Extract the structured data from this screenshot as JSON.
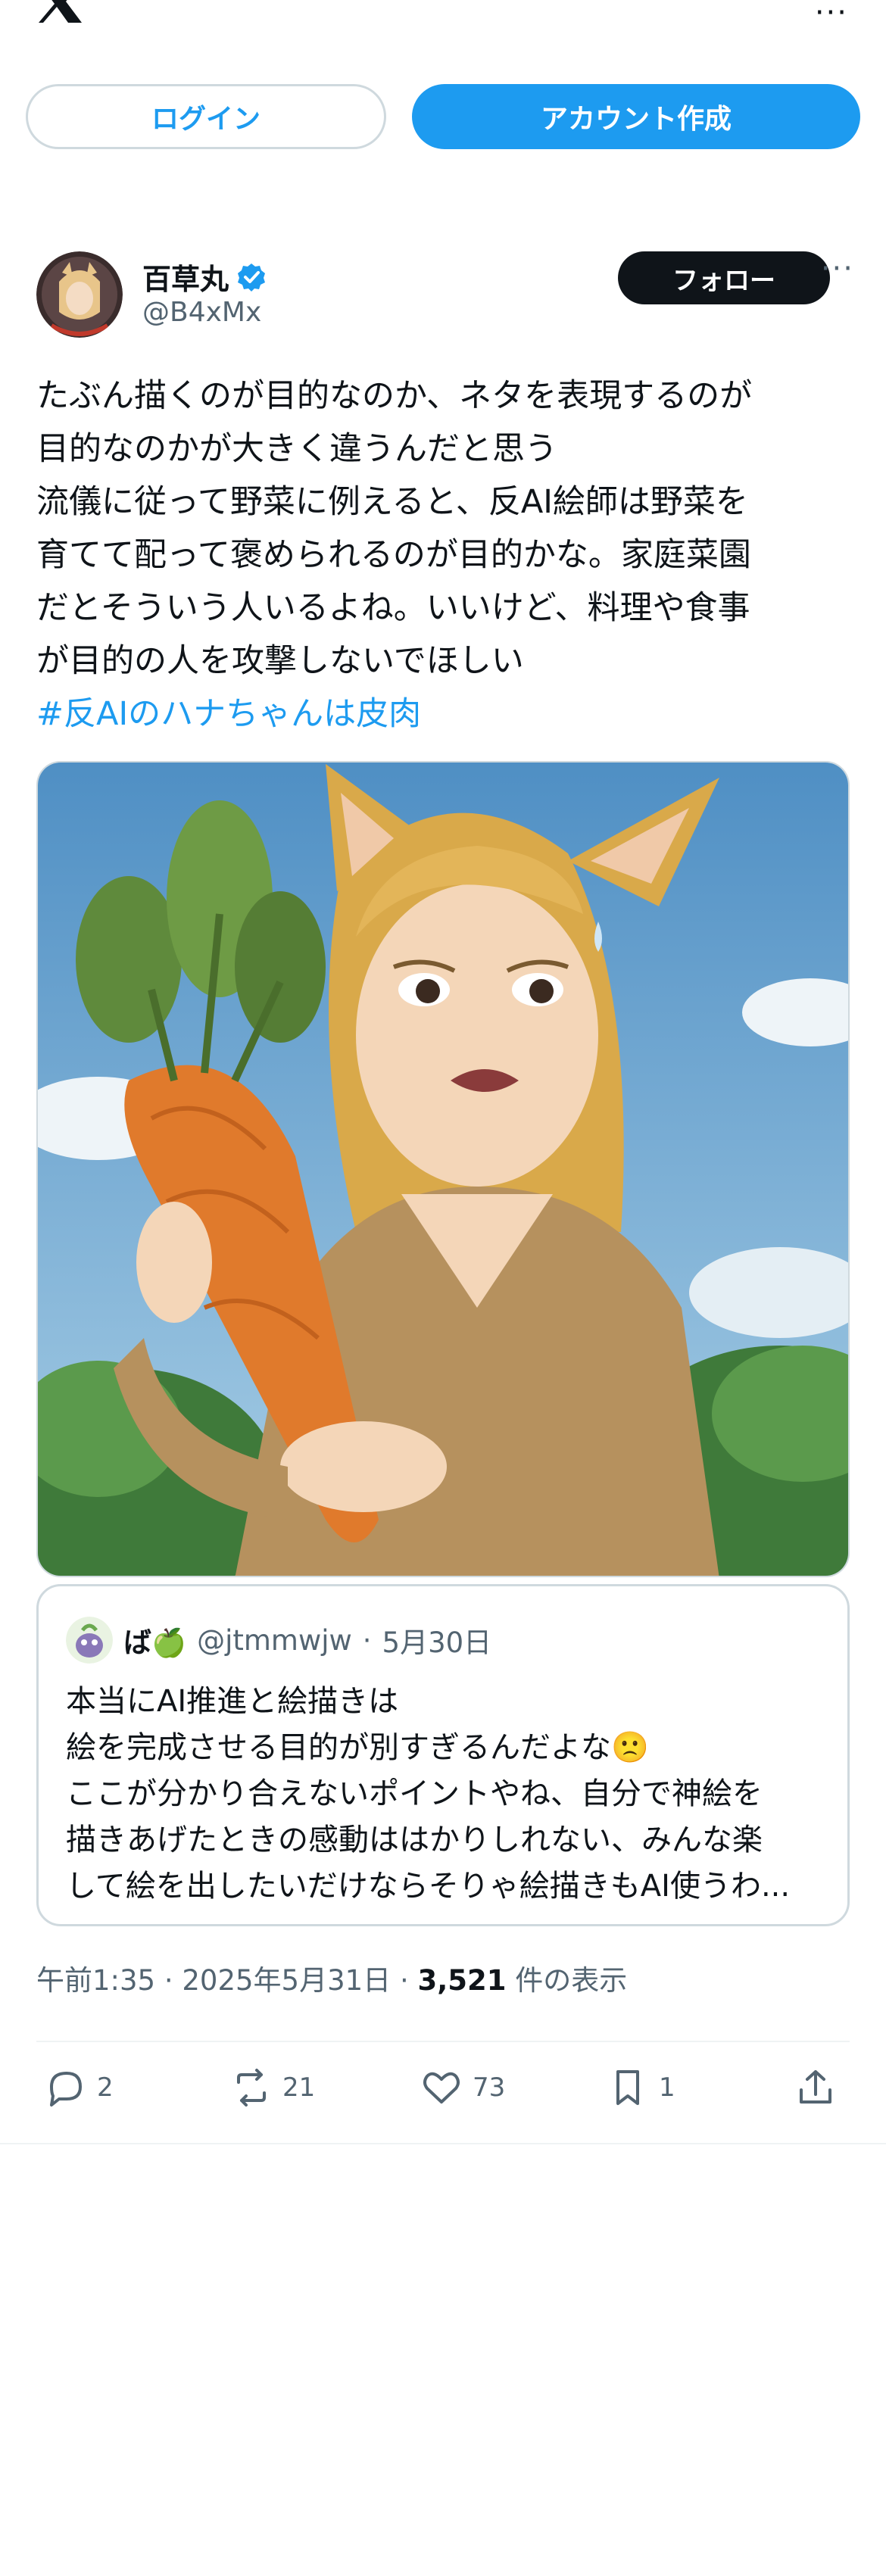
{
  "topbar": {
    "logo_icon": "x-logo-icon",
    "more_icon": "more-horizontal-icon",
    "more_glyph": "···"
  },
  "auth": {
    "login_label": "ログイン",
    "signup_label": "アカウント作成"
  },
  "author": {
    "display_name": "百草丸",
    "handle": "@B4xMx",
    "verified_icon": "verified-badge-icon",
    "follow_label": "フォロー",
    "more_glyph": "···"
  },
  "tweet": {
    "lines": [
      "たぶん描くのが目的なのか、ネタを表現するのが",
      "目的なのかが大きく違うんだと思う",
      "流儀に従って野菜に例えると、反AI絵師は野菜を",
      "育てて配って褒められるのが目的かな。家庭菜園",
      "だとそういう人いるよね。いいけど、料理や食事",
      "が目的の人を攻撃しないでほしい"
    ],
    "hashtag": "#反AIのハナちゃんは皮肉"
  },
  "quote": {
    "name": "ば🍏",
    "handle": "@jtmmwjw",
    "date": "5月30日",
    "lines": [
      "本当にAI推進と絵描きは",
      "絵を完成させる目的が別すぎるんだよな🙁",
      "ここが分かり合えないポイントやね、自分で神絵を",
      "描きあげたときの感動ははかりしれない、みんな楽",
      "して絵を出したいだけならそりゃ絵描きもAI使うわ..."
    ]
  },
  "meta": {
    "time": "午前1:35",
    "date": "2025年5月31日",
    "views_count": "3,521",
    "views_label": "件の表示",
    "dot": "·"
  },
  "actions": {
    "replies": "2",
    "reposts": "21",
    "likes": "73",
    "bookmarks": "1"
  },
  "colors": {
    "accent": "#1d9bf0",
    "text": "#0f1419",
    "muted": "#536471",
    "border": "#cfd9de"
  }
}
